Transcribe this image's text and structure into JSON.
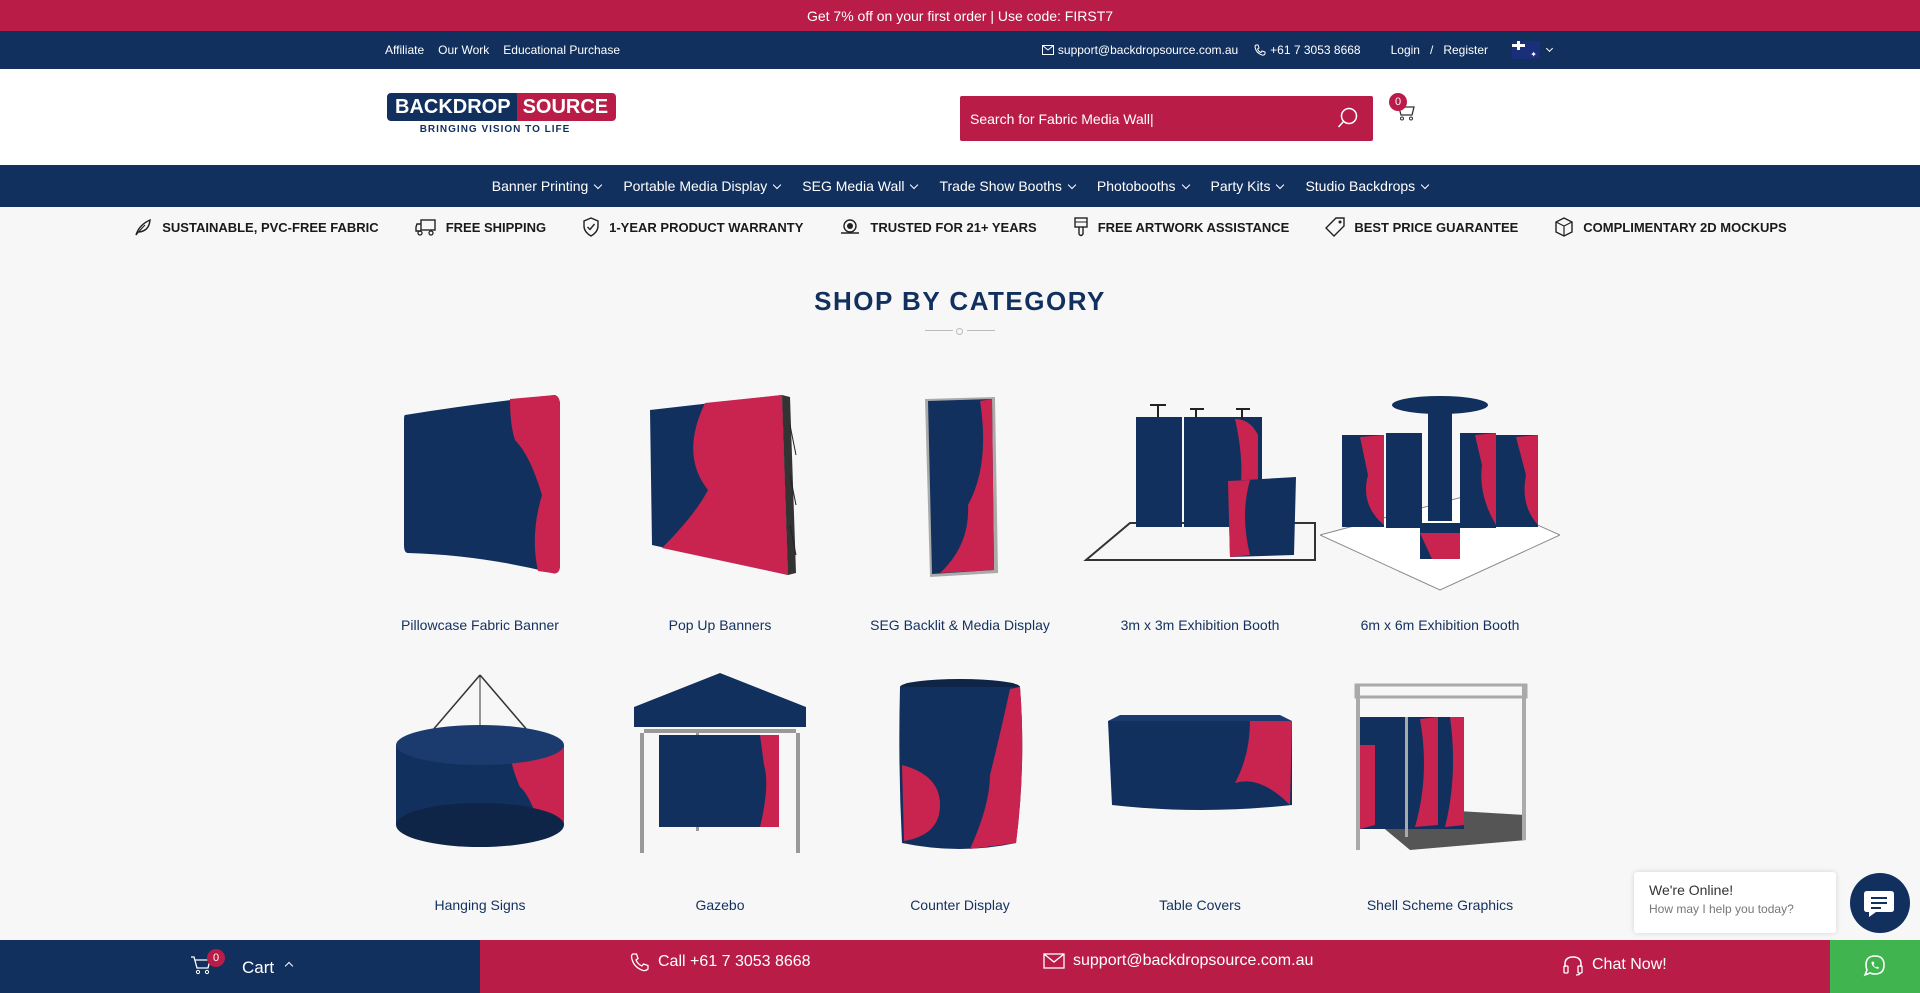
{
  "promo": {
    "text": "Get 7% off on your first order | Use code: FIRST7"
  },
  "topbar": {
    "links": [
      "Affiliate",
      "Our Work",
      "Educational Purchase"
    ],
    "email": "support@backdropsource.com.au",
    "phone": "+61 7 3053 8668",
    "login": "Login",
    "separator": "/",
    "register": "Register"
  },
  "logo": {
    "left": "BACKDROP",
    "right": "SOURCE",
    "tagline": "BRINGING VISION TO LIFE"
  },
  "search": {
    "value": "Search for Fabric Media Wall|"
  },
  "cart_top": {
    "count": "0"
  },
  "nav": [
    "Banner Printing",
    "Portable Media Display",
    "SEG Media Wall",
    "Trade Show Booths",
    "Photobooths",
    "Party Kits",
    "Studio Backdrops"
  ],
  "features": [
    {
      "label": "SUSTAINABLE, PVC-FREE FABRIC",
      "icon": "leaf-icon"
    },
    {
      "label": "FREE SHIPPING",
      "icon": "truck-icon"
    },
    {
      "label": "1-YEAR PRODUCT WARRANTY",
      "icon": "shield-check-icon"
    },
    {
      "label": "TRUSTED FOR 21+ YEARS",
      "icon": "award-icon"
    },
    {
      "label": "FREE ARTWORK ASSISTANCE",
      "icon": "brush-icon"
    },
    {
      "label": "BEST PRICE GUARANTEE",
      "icon": "tag-icon"
    },
    {
      "label": "COMPLIMENTARY 2D MOCKUPS",
      "icon": "cube-icon"
    }
  ],
  "section": {
    "title": "SHOP BY CATEGORY"
  },
  "categories": [
    "Pillowcase Fabric Banner",
    "Pop Up Banners",
    "SEG Backlit & Media Display",
    "3m x 3m Exhibition Booth",
    "6m x 6m Exhibition Booth",
    "Hanging Signs",
    "Gazebo",
    "Counter Display",
    "Table Covers",
    "Shell Scheme Graphics"
  ],
  "bottom": {
    "cart_count": "0",
    "cart_label": "Cart",
    "call": "Call +61 7 3053 8668",
    "email": "support@backdropsource.com.au",
    "chat": "Chat Now!"
  },
  "chat_widget": {
    "title": "We're Online!",
    "subtitle": "How may I help you today?"
  },
  "colors": {
    "navy": "#12305e",
    "crimson": "#b91c47",
    "whatsapp": "#3fb44f"
  }
}
